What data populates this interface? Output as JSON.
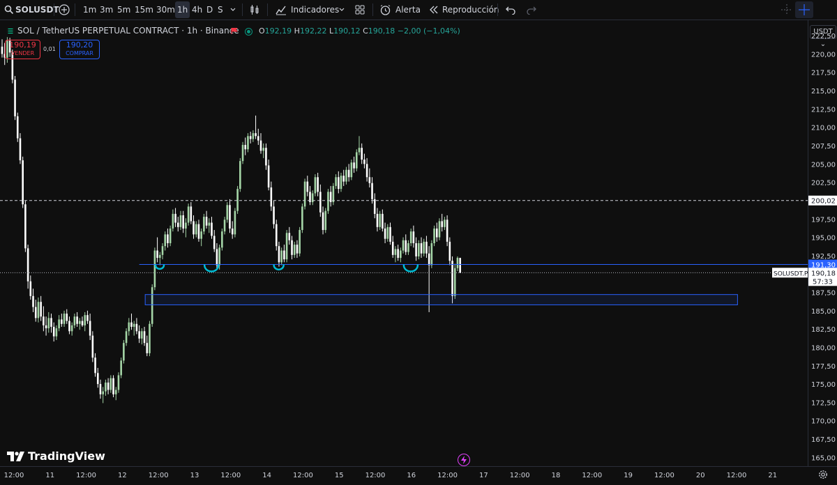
{
  "toolbar": {
    "symbol": "SOLUSDT",
    "intervals": [
      "1m",
      "3m",
      "5m",
      "15m",
      "30m",
      "1h",
      "4h",
      "D",
      "S"
    ],
    "selected_interval": "1h",
    "indicators_label": "Indicadores",
    "alert_label": "Alerta",
    "replay_label": "Reproducción"
  },
  "legend": {
    "title": "SOL / TetherUS PERPETUAL CONTRACT · 1h · Binance",
    "open_label": "O",
    "open": "192,19",
    "high_label": "H",
    "high": "192,22",
    "low_label": "L",
    "low": "190,12",
    "close_label": "C",
    "close": "190,18",
    "change": "−2,00 (−1,04%)"
  },
  "trade": {
    "sell_price": "190,19",
    "sell_label": "VENDER",
    "spread": "0,01",
    "buy_price": "190,20",
    "buy_label": "COMPRAR"
  },
  "price_axis": {
    "currency": "USDT",
    "ticks": [
      "222,50",
      "220,00",
      "217,50",
      "215,00",
      "212,50",
      "210,00",
      "207,50",
      "205,00",
      "202,50",
      "200,00",
      "197,50",
      "195,00",
      "192,50",
      "190,00",
      "187,50",
      "185,00",
      "182,50",
      "180,00",
      "177,50",
      "175,00",
      "172,50",
      "170,00",
      "167,50",
      "165,00"
    ],
    "tag_level_dashed": "200,02",
    "tag_level_support": "191,30",
    "tag_symbol": "SOLUSDT.P",
    "tag_last": "190,18",
    "tag_countdown": "57:33"
  },
  "time_axis": {
    "labels": [
      "12:00",
      "11",
      "12:00",
      "12",
      "12:00",
      "13",
      "12:00",
      "14",
      "12:00",
      "15",
      "12:00",
      "16",
      "12:00",
      "17",
      "12:00",
      "18",
      "12:00",
      "19",
      "12:00",
      "20",
      "12:00",
      "21"
    ]
  },
  "branding": {
    "logo_text": "TradingView"
  },
  "colors": {
    "up": "#a5d6a7",
    "down": "#ffffff",
    "accent": "#2962ff",
    "sell": "#f23645",
    "buy": "#2962ff",
    "highlight": "#00bcd4"
  },
  "chart_data": {
    "type": "candlestick",
    "ylim": [
      163.8,
      224.6
    ],
    "x_range_hours": [
      0,
      265
    ],
    "levels": {
      "dashed_resistance": 200.02,
      "support_line": 191.3,
      "zone": [
        185.8,
        187.2
      ],
      "last_price": 190.18
    },
    "last": {
      "open": 192.19,
      "high": 192.22,
      "low": 190.12,
      "close": 190.18
    },
    "candles": [
      [
        0,
        221.0,
        222.0,
        219.5,
        220.0
      ],
      [
        1,
        220.0,
        221.5,
        218.5,
        219.5
      ],
      [
        2,
        219.5,
        222.3,
        218.8,
        221.8
      ],
      [
        3,
        221.8,
        222.2,
        219.6,
        220.2
      ],
      [
        4,
        220.2,
        220.6,
        216.0,
        216.5
      ],
      [
        5,
        216.5,
        217.0,
        211.0,
        211.5
      ],
      [
        6,
        211.5,
        212.0,
        208.0,
        208.5
      ],
      [
        7,
        208.5,
        209.2,
        205.0,
        205.5
      ],
      [
        8,
        205.5,
        206.0,
        199.0,
        199.5
      ],
      [
        9,
        199.5,
        200.0,
        193.0,
        193.5
      ],
      [
        10,
        193.5,
        194.0,
        188.0,
        189.0
      ],
      [
        11,
        189.0,
        189.8,
        186.5,
        187.0
      ],
      [
        12,
        187.0,
        188.0,
        184.8,
        185.5
      ],
      [
        13,
        185.5,
        186.5,
        183.5,
        184.0
      ],
      [
        14,
        184.0,
        186.8,
        183.4,
        186.2
      ],
      [
        15,
        186.2,
        187.0,
        183.6,
        184.2
      ],
      [
        16,
        184.2,
        185.6,
        182.2,
        183.0
      ],
      [
        17,
        183.0,
        184.2,
        181.6,
        182.6
      ],
      [
        18,
        182.6,
        184.8,
        182.0,
        184.0
      ],
      [
        19,
        184.0,
        184.6,
        182.0,
        182.8
      ],
      [
        20,
        182.8,
        183.4,
        180.8,
        181.5
      ],
      [
        21,
        181.5,
        183.0,
        181.0,
        182.6
      ],
      [
        22,
        182.6,
        184.4,
        182.2,
        183.8
      ],
      [
        23,
        183.8,
        184.6,
        182.8,
        183.2
      ],
      [
        24,
        183.2,
        185.0,
        182.8,
        184.6
      ],
      [
        25,
        184.6,
        185.2,
        183.2,
        183.6
      ],
      [
        26,
        183.6,
        184.2,
        181.8,
        182.2
      ],
      [
        27,
        182.2,
        183.4,
        181.6,
        183.0
      ],
      [
        28,
        183.0,
        184.6,
        182.6,
        184.2
      ],
      [
        29,
        184.2,
        184.8,
        182.8,
        183.2
      ],
      [
        30,
        183.2,
        184.0,
        182.4,
        183.6
      ],
      [
        31,
        183.6,
        184.2,
        182.8,
        183.0
      ],
      [
        32,
        183.0,
        184.8,
        182.2,
        184.4
      ],
      [
        33,
        184.4,
        185.0,
        183.2,
        183.6
      ],
      [
        34,
        183.6,
        184.6,
        181.0,
        181.6
      ],
      [
        35,
        181.6,
        182.2,
        178.0,
        178.6
      ],
      [
        36,
        178.6,
        179.2,
        176.0,
        176.5
      ],
      [
        37,
        176.5,
        177.2,
        174.5,
        175.0
      ],
      [
        38,
        175.0,
        175.6,
        173.0,
        173.6
      ],
      [
        39,
        173.6,
        174.6,
        172.4,
        174.0
      ],
      [
        40,
        174.0,
        175.6,
        173.4,
        175.2
      ],
      [
        41,
        175.2,
        175.8,
        173.6,
        174.2
      ],
      [
        42,
        174.2,
        176.2,
        173.8,
        175.8
      ],
      [
        43,
        175.8,
        176.2,
        173.2,
        173.6
      ],
      [
        44,
        173.6,
        174.6,
        172.8,
        174.2
      ],
      [
        45,
        174.2,
        176.6,
        173.8,
        176.2
      ],
      [
        46,
        176.2,
        178.6,
        175.8,
        178.2
      ],
      [
        47,
        178.2,
        181.0,
        177.8,
        180.6
      ],
      [
        48,
        180.6,
        182.6,
        180.2,
        182.2
      ],
      [
        49,
        182.2,
        184.0,
        181.6,
        183.4
      ],
      [
        50,
        183.4,
        184.6,
        182.4,
        182.8
      ],
      [
        51,
        182.8,
        183.6,
        181.6,
        183.2
      ],
      [
        52,
        183.2,
        184.0,
        181.8,
        182.2
      ],
      [
        53,
        182.2,
        183.0,
        180.6,
        181.2
      ],
      [
        54,
        181.2,
        182.6,
        180.4,
        182.2
      ],
      [
        55,
        182.2,
        182.8,
        180.2,
        180.6
      ],
      [
        56,
        180.6,
        181.6,
        178.8,
        179.2
      ],
      [
        57,
        179.2,
        183.6,
        178.8,
        183.2
      ],
      [
        58,
        183.2,
        188.6,
        182.8,
        188.2
      ],
      [
        59,
        188.2,
        193.6,
        187.8,
        193.2
      ],
      [
        60,
        193.2,
        195.0,
        191.6,
        192.2
      ],
      [
        61,
        192.2,
        193.0,
        191.2,
        192.6
      ],
      [
        62,
        192.6,
        194.2,
        192.0,
        193.8
      ],
      [
        63,
        193.8,
        195.8,
        193.2,
        195.4
      ],
      [
        64,
        195.4,
        196.2,
        193.6,
        194.2
      ],
      [
        65,
        194.2,
        196.6,
        193.8,
        196.2
      ],
      [
        66,
        196.2,
        198.8,
        195.8,
        198.2
      ],
      [
        67,
        198.2,
        199.0,
        196.4,
        197.0
      ],
      [
        68,
        197.0,
        197.8,
        195.8,
        196.4
      ],
      [
        69,
        196.4,
        198.6,
        196.0,
        198.0
      ],
      [
        70,
        198.0,
        198.6,
        195.6,
        196.2
      ],
      [
        71,
        196.2,
        197.6,
        195.0,
        197.0
      ],
      [
        72,
        197.0,
        199.6,
        196.6,
        199.2
      ],
      [
        73,
        199.2,
        199.8,
        196.8,
        197.2
      ],
      [
        74,
        197.2,
        198.0,
        194.8,
        195.4
      ],
      [
        75,
        195.4,
        197.2,
        195.0,
        196.8
      ],
      [
        76,
        196.8,
        197.4,
        194.4,
        194.8
      ],
      [
        77,
        194.8,
        196.2,
        193.8,
        195.8
      ],
      [
        78,
        195.8,
        198.2,
        195.4,
        197.8
      ],
      [
        79,
        197.8,
        198.6,
        196.2,
        196.6
      ],
      [
        80,
        196.6,
        197.6,
        195.6,
        197.0
      ],
      [
        81,
        197.0,
        197.8,
        194.8,
        195.2
      ],
      [
        82,
        195.2,
        196.0,
        193.0,
        193.4
      ],
      [
        83,
        193.4,
        194.2,
        190.6,
        191.2
      ],
      [
        84,
        191.2,
        194.0,
        190.6,
        193.6
      ],
      [
        85,
        193.6,
        196.2,
        193.2,
        195.8
      ],
      [
        86,
        195.8,
        197.8,
        195.4,
        197.4
      ],
      [
        87,
        197.4,
        199.8,
        197.0,
        199.4
      ],
      [
        88,
        199.4,
        200.2,
        195.6,
        196.2
      ],
      [
        89,
        196.2,
        197.2,
        194.8,
        195.4
      ],
      [
        90,
        195.4,
        199.0,
        195.0,
        198.6
      ],
      [
        91,
        198.6,
        202.0,
        198.2,
        201.6
      ],
      [
        92,
        201.6,
        205.8,
        201.2,
        205.4
      ],
      [
        93,
        205.4,
        208.0,
        205.0,
        207.6
      ],
      [
        94,
        207.6,
        208.6,
        206.2,
        207.0
      ],
      [
        95,
        207.0,
        209.2,
        206.6,
        208.8
      ],
      [
        96,
        208.8,
        209.4,
        207.8,
        208.4
      ],
      [
        97,
        208.4,
        209.6,
        208.0,
        209.2
      ],
      [
        98,
        209.2,
        211.6,
        208.4,
        208.8
      ],
      [
        99,
        208.8,
        209.8,
        207.6,
        208.2
      ],
      [
        100,
        208.2,
        209.2,
        206.4,
        206.8
      ],
      [
        101,
        206.8,
        207.8,
        205.8,
        207.2
      ],
      [
        102,
        207.2,
        207.8,
        204.2,
        204.8
      ],
      [
        103,
        204.8,
        205.6,
        201.4,
        201.8
      ],
      [
        104,
        201.8,
        202.6,
        198.6,
        199.2
      ],
      [
        105,
        199.2,
        200.0,
        196.2,
        196.8
      ],
      [
        106,
        196.8,
        197.4,
        193.2,
        193.8
      ],
      [
        107,
        193.8,
        194.4,
        191.0,
        191.6
      ],
      [
        108,
        191.6,
        193.6,
        191.2,
        193.2
      ],
      [
        109,
        193.2,
        194.0,
        191.6,
        192.0
      ],
      [
        110,
        192.0,
        196.0,
        191.6,
        195.6
      ],
      [
        111,
        195.6,
        196.4,
        194.0,
        194.6
      ],
      [
        112,
        194.6,
        195.2,
        192.0,
        192.6
      ],
      [
        113,
        192.6,
        194.4,
        192.2,
        194.0
      ],
      [
        114,
        194.0,
        194.6,
        192.2,
        192.8
      ],
      [
        115,
        192.8,
        196.4,
        192.4,
        196.0
      ],
      [
        116,
        196.0,
        199.6,
        195.6,
        199.2
      ],
      [
        117,
        199.2,
        203.0,
        198.8,
        202.6
      ],
      [
        118,
        202.6,
        203.4,
        200.6,
        201.2
      ],
      [
        119,
        201.2,
        202.0,
        199.4,
        199.8
      ],
      [
        120,
        199.8,
        201.4,
        199.4,
        201.0
      ],
      [
        121,
        201.0,
        203.6,
        200.6,
        203.2
      ],
      [
        122,
        203.2,
        203.8,
        200.6,
        201.2
      ],
      [
        123,
        201.2,
        202.2,
        197.8,
        198.4
      ],
      [
        124,
        198.4,
        199.2,
        195.4,
        196.0
      ],
      [
        125,
        196.0,
        199.0,
        195.6,
        198.6
      ],
      [
        126,
        198.6,
        201.6,
        198.2,
        201.2
      ],
      [
        127,
        201.2,
        202.0,
        199.2,
        199.8
      ],
      [
        128,
        199.8,
        202.4,
        199.4,
        202.0
      ],
      [
        129,
        202.0,
        203.6,
        201.6,
        203.2
      ],
      [
        130,
        203.2,
        204.0,
        201.0,
        201.6
      ],
      [
        131,
        201.6,
        203.8,
        201.2,
        203.4
      ],
      [
        132,
        203.4,
        204.2,
        202.0,
        202.6
      ],
      [
        133,
        202.6,
        204.6,
        202.2,
        204.2
      ],
      [
        134,
        204.2,
        205.0,
        202.6,
        203.2
      ],
      [
        135,
        203.2,
        205.6,
        202.8,
        205.2
      ],
      [
        136,
        205.2,
        206.0,
        203.8,
        204.4
      ],
      [
        137,
        204.4,
        207.0,
        204.0,
        206.6
      ],
      [
        138,
        206.6,
        208.8,
        206.2,
        207.2
      ],
      [
        139,
        207.2,
        207.8,
        205.0,
        205.6
      ],
      [
        140,
        205.6,
        206.4,
        204.4,
        205.0
      ],
      [
        141,
        205.0,
        205.8,
        202.6,
        203.2
      ],
      [
        142,
        203.2,
        204.4,
        201.8,
        202.4
      ],
      [
        143,
        202.4,
        203.2,
        199.6,
        200.2
      ],
      [
        144,
        200.2,
        201.0,
        197.6,
        198.2
      ],
      [
        145,
        198.2,
        199.0,
        195.8,
        196.4
      ],
      [
        146,
        196.4,
        198.6,
        196.0,
        198.2
      ],
      [
        147,
        198.2,
        198.8,
        195.8,
        196.2
      ],
      [
        148,
        196.2,
        197.0,
        194.2,
        194.8
      ],
      [
        149,
        194.8,
        196.8,
        194.4,
        196.4
      ],
      [
        150,
        196.4,
        197.0,
        194.0,
        194.4
      ],
      [
        151,
        194.4,
        195.2,
        192.2,
        192.6
      ],
      [
        152,
        192.6,
        193.8,
        191.6,
        193.4
      ],
      [
        153,
        193.4,
        194.0,
        191.8,
        192.2
      ],
      [
        154,
        192.2,
        193.6,
        191.6,
        193.2
      ],
      [
        155,
        193.2,
        195.0,
        192.8,
        194.6
      ],
      [
        156,
        194.6,
        195.4,
        192.6,
        193.0
      ],
      [
        157,
        193.0,
        194.6,
        192.6,
        194.2
      ],
      [
        158,
        194.2,
        196.2,
        193.8,
        195.8
      ],
      [
        159,
        195.8,
        196.6,
        193.6,
        194.2
      ],
      [
        160,
        194.2,
        195.0,
        191.8,
        192.4
      ],
      [
        161,
        192.4,
        194.6,
        192.0,
        194.2
      ],
      [
        162,
        194.2,
        195.0,
        192.2,
        192.8
      ],
      [
        163,
        192.8,
        194.8,
        192.4,
        194.4
      ],
      [
        164,
        194.4,
        195.2,
        192.2,
        192.8
      ],
      [
        165,
        192.8,
        193.8,
        184.8,
        191.2
      ],
      [
        166,
        191.2,
        194.6,
        190.8,
        194.2
      ],
      [
        167,
        194.2,
        196.6,
        193.8,
        196.2
      ],
      [
        168,
        196.2,
        197.0,
        194.4,
        195.0
      ],
      [
        169,
        195.0,
        197.6,
        194.6,
        197.2
      ],
      [
        170,
        197.2,
        198.2,
        195.8,
        196.4
      ],
      [
        171,
        196.4,
        197.8,
        196.0,
        197.4
      ],
      [
        172,
        197.4,
        198.0,
        193.8,
        194.4
      ],
      [
        173,
        194.4,
        195.0,
        191.2,
        191.8
      ],
      [
        174,
        191.8,
        192.4,
        186.0,
        187.0
      ],
      [
        175,
        187.0,
        191.4,
        186.6,
        190.8
      ],
      [
        176,
        190.8,
        192.4,
        190.4,
        192.2
      ],
      [
        177,
        192.19,
        192.22,
        190.12,
        190.18
      ]
    ]
  }
}
